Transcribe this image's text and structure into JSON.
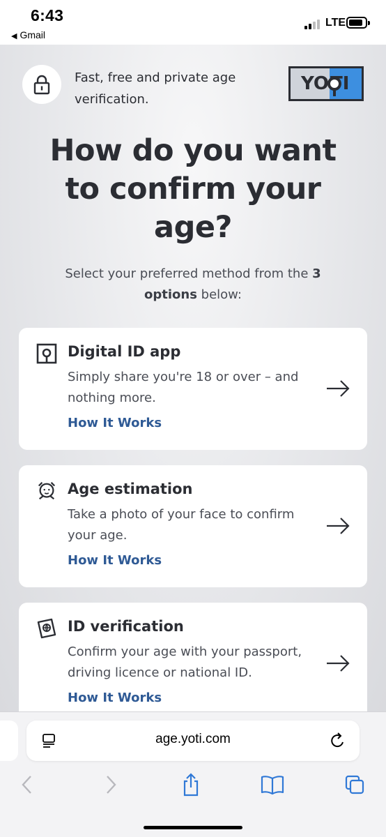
{
  "status_bar": {
    "time": "6:43",
    "back_app": "Gmail",
    "network": "LTE"
  },
  "header": {
    "lock_icon": "lock-icon",
    "tagline": "Fast, free and private age verification.",
    "logo_left": "YO",
    "logo_right": "TI"
  },
  "main": {
    "heading": "How do you want to confirm your age?",
    "subtitle_pre": "Select your preferred method from the ",
    "subtitle_bold": "3 options",
    "subtitle_post": " below:"
  },
  "options": [
    {
      "icon": "digital-id-icon",
      "title": "Digital ID app",
      "description": "Simply share you're 18 or over – and nothing more.",
      "link": "How It Works"
    },
    {
      "icon": "face-scan-icon",
      "title": "Age estimation",
      "description": "Take a photo of your face to confirm your age.",
      "link": "How It Works"
    },
    {
      "icon": "passport-icon",
      "title": "ID verification",
      "description": "Confirm your age with your passport, driving licence or national ID.",
      "link": "How It Works"
    }
  ],
  "browser": {
    "url": "age.yoti.com",
    "icons": [
      "reader-icon",
      "reload-icon",
      "back-icon",
      "forward-icon",
      "share-icon",
      "bookmarks-icon",
      "tabs-icon"
    ]
  },
  "colors": {
    "link": "#2f5a95",
    "text": "#2b2d33",
    "logo_blue": "#3d8fe0"
  }
}
